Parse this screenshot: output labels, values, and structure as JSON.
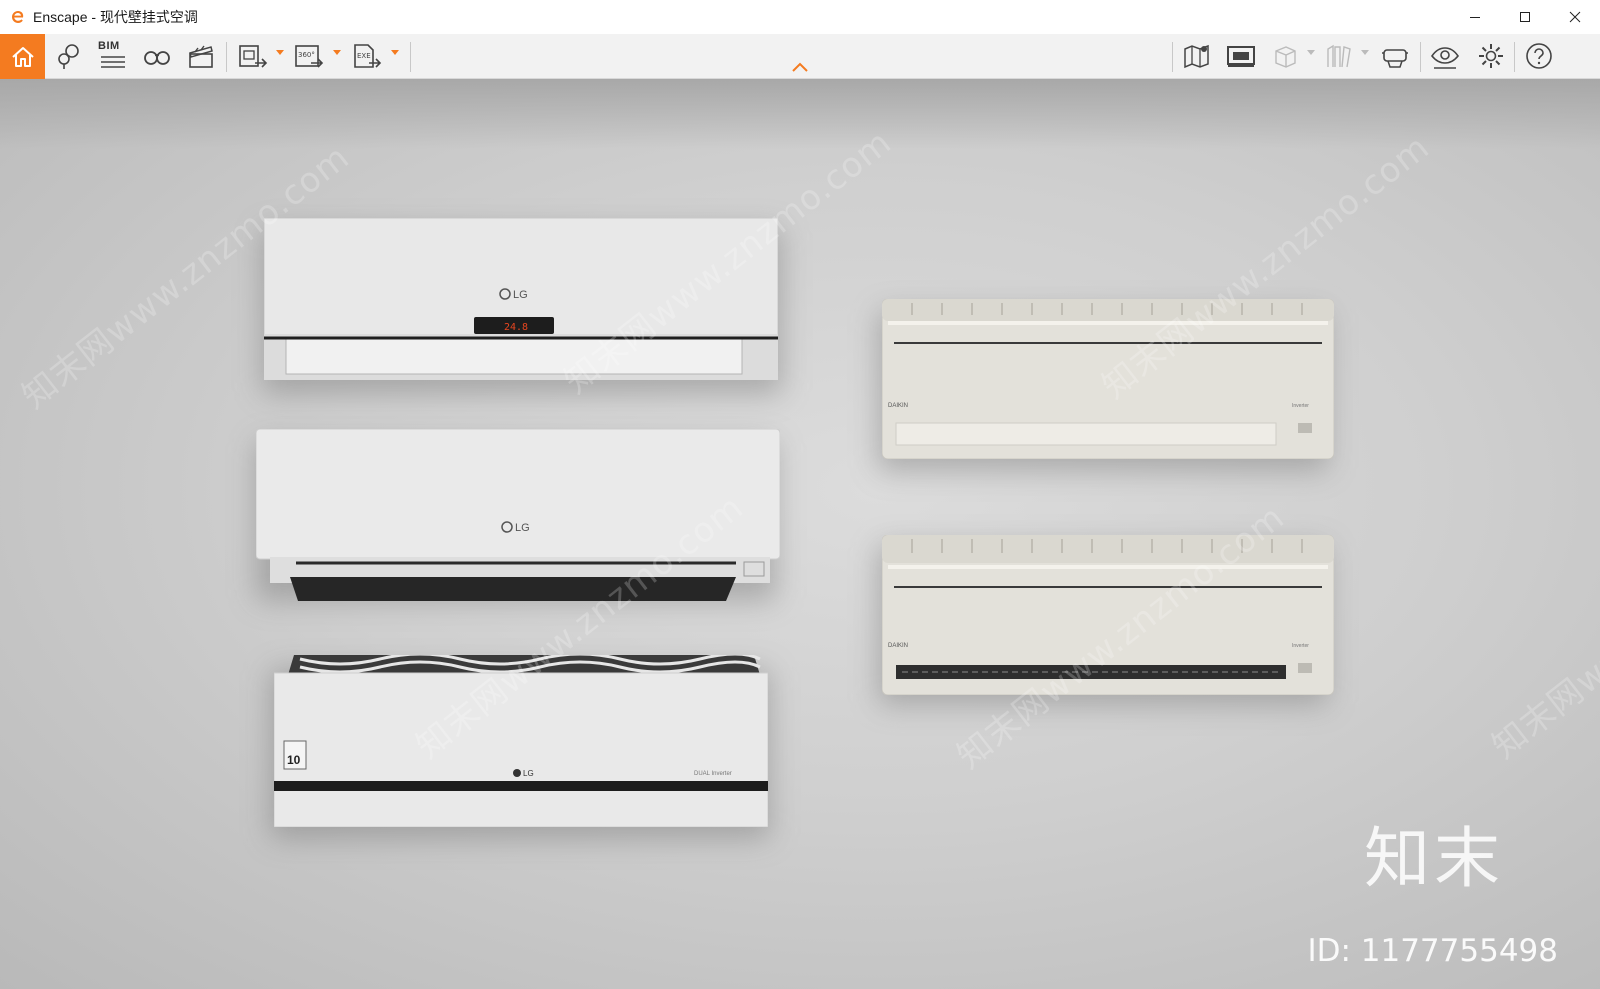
{
  "window": {
    "app_name": "Enscape",
    "separator": " - ",
    "document_title": "现代壁挂式空调",
    "controls": {
      "minimize": "minimize-icon",
      "maximize": "maximize-icon",
      "close": "close-icon"
    }
  },
  "toolbar": {
    "accent_color": "#f47b20",
    "bim_label": "BIM",
    "pano_label": "360°",
    "exe_label": "EXE",
    "left_buttons": [
      "home-icon",
      "map-pin-icon",
      "bim-list-icon",
      "binoculars-icon",
      "clapper-icon",
      "export-image-icon",
      "export-360-icon",
      "export-exe-icon"
    ],
    "right_buttons": [
      "map-icon",
      "screen-icon",
      "cube-icon",
      "books-icon",
      "vr-headset-icon",
      "eye-icon",
      "gear-icon",
      "help-icon"
    ]
  },
  "scene": {
    "units": [
      {
        "brand": "LG",
        "display": "24.8"
      },
      {
        "brand": "LG"
      },
      {
        "brand": "LG",
        "badge": "10",
        "tag": "DUAL Inverter"
      },
      {
        "brand": "DAIKIN",
        "tag": "Inverter"
      },
      {
        "brand": "DAIKIN",
        "tag": "Inverter"
      }
    ],
    "watermark_text": "知末网www.znzmo.com",
    "brand_watermark": "知末",
    "id_watermark": "ID: 1177755498"
  }
}
